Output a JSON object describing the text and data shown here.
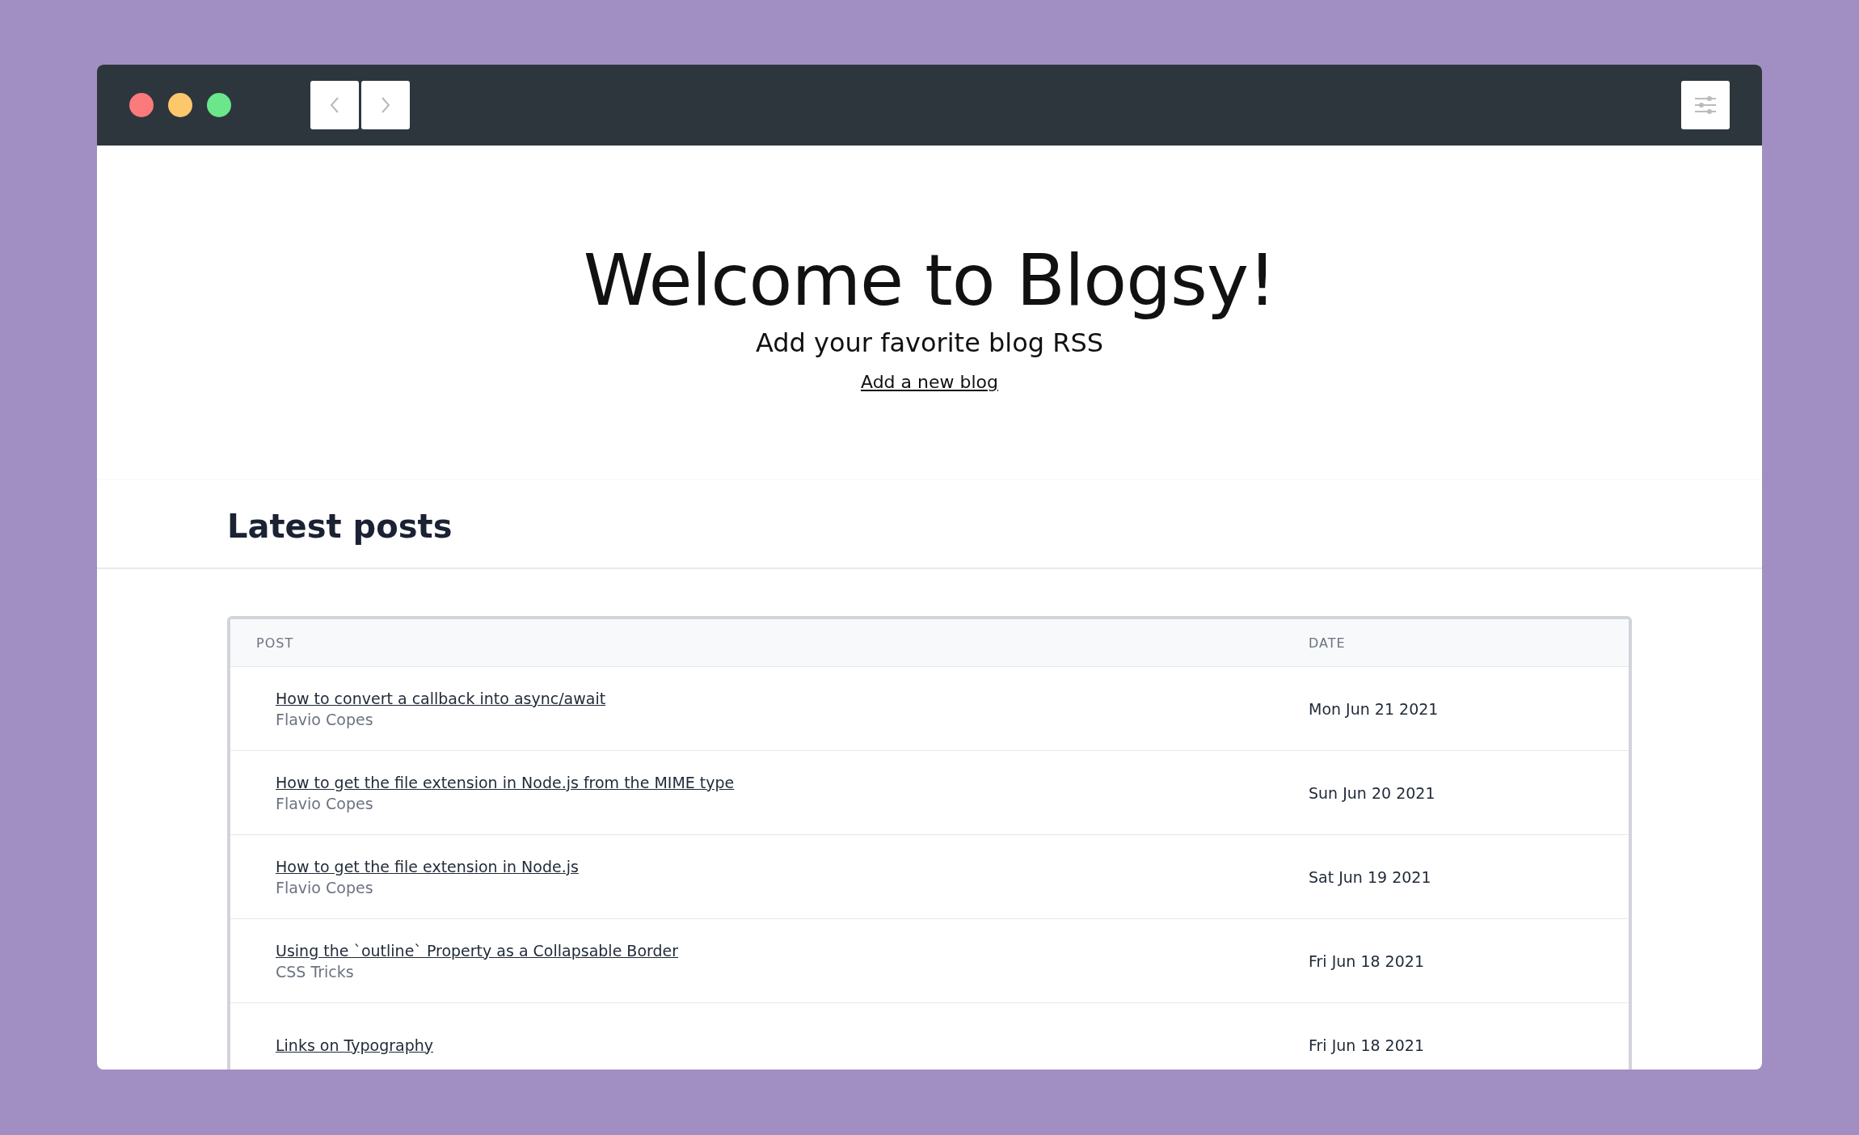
{
  "hero": {
    "title": "Welcome to Blogsy!",
    "subtitle": "Add your favorite blog RSS",
    "link": "Add a new blog"
  },
  "section": {
    "title": "Latest posts"
  },
  "table": {
    "columns": [
      "POST",
      "DATE"
    ],
    "rows": [
      {
        "title": "How to convert a callback into async/await",
        "author": "Flavio Copes",
        "date": "Mon Jun 21 2021"
      },
      {
        "title": "How to get the file extension in Node.js from the MIME type",
        "author": "Flavio Copes",
        "date": "Sun Jun 20 2021"
      },
      {
        "title": "How to get the file extension in Node.js",
        "author": "Flavio Copes",
        "date": "Sat Jun 19 2021"
      },
      {
        "title": "Using the `outline` Property as a Collapsable Border",
        "author": "CSS Tricks",
        "date": "Fri Jun 18 2021"
      },
      {
        "title": "Links on Typography",
        "date": "Fri Jun 18 2021"
      }
    ]
  }
}
